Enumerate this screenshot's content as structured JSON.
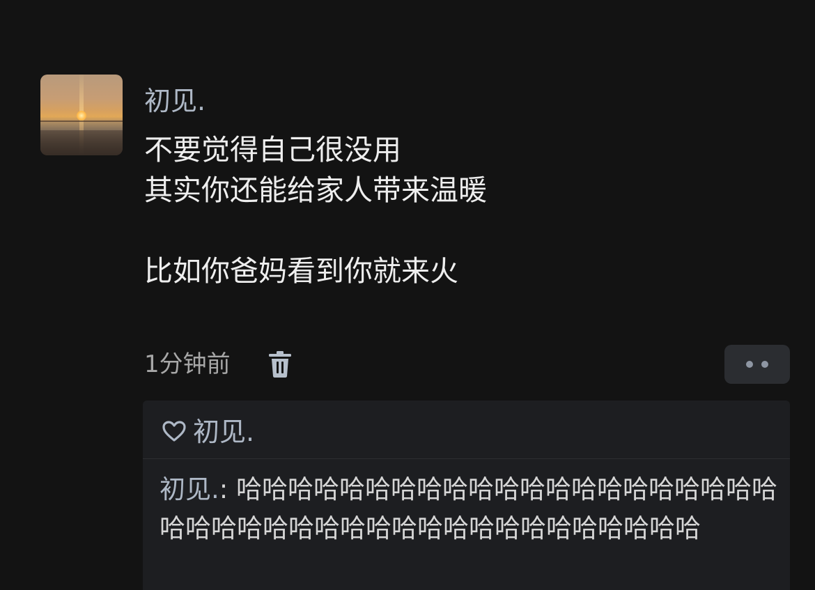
{
  "post": {
    "author": "初见.",
    "content": {
      "line1": "不要觉得自己很没用",
      "line2": "其实你还能给家人带来温暖",
      "line3": "比如你爸妈看到你就来火"
    },
    "timestamp": "1分钟前"
  },
  "likes": {
    "names": "初见."
  },
  "comments": [
    {
      "author": "初见.",
      "separator": ": ",
      "text": "哈哈哈哈哈哈哈哈哈哈哈哈哈哈哈哈哈哈哈哈哈哈哈哈哈哈哈哈哈哈哈哈哈哈哈哈哈哈哈哈哈哈"
    }
  ],
  "icons": {
    "avatar": "sunset-photo",
    "delete": "trash-icon",
    "more": "more-dots-icon",
    "like": "heart-icon"
  },
  "colors": {
    "background": "#131313",
    "name": "#aeb8c6",
    "content": "#eeeeee",
    "meta": "#a7a7a7",
    "panel": "#1d1e21",
    "button": "#2b2d31"
  }
}
